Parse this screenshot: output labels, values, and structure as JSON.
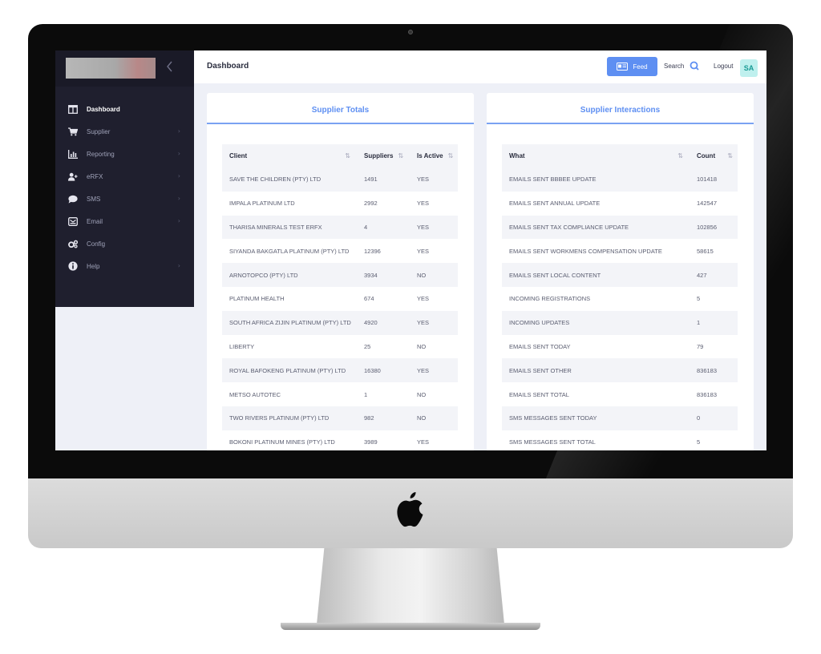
{
  "topbar": {
    "title": "Dashboard",
    "feed_label": "Feed",
    "search_label": "Search",
    "logout_label": "Logout",
    "avatar_initials": "SA"
  },
  "sidebar": {
    "items": [
      {
        "label": "Dashboard",
        "icon": "columns-icon",
        "active": true,
        "chevron": false
      },
      {
        "label": "Supplier",
        "icon": "cart-icon",
        "active": false,
        "chevron": true
      },
      {
        "label": "Reporting",
        "icon": "chart-icon",
        "active": false,
        "chevron": true
      },
      {
        "label": "eRFX",
        "icon": "user-plus-icon",
        "active": false,
        "chevron": true
      },
      {
        "label": "SMS",
        "icon": "chat-bubble-icon",
        "active": false,
        "chevron": true
      },
      {
        "label": "Email",
        "icon": "envelope-icon",
        "active": false,
        "chevron": true
      },
      {
        "label": "Config",
        "icon": "cogs-icon",
        "active": false,
        "chevron": false
      },
      {
        "label": "Help",
        "icon": "info-icon",
        "active": false,
        "chevron": true
      }
    ]
  },
  "supplier_totals": {
    "title": "Supplier Totals",
    "columns": [
      "Client",
      "Suppliers",
      "Is Active"
    ],
    "rows": [
      [
        "SAVE THE CHILDREN (PTY) LTD",
        "1491",
        "YES"
      ],
      [
        "IMPALA PLATINUM LTD",
        "2992",
        "YES"
      ],
      [
        "THARISA MINERALS TEST ERFX",
        "4",
        "YES"
      ],
      [
        "SIYANDA BAKGATLA PLATINUM (PTY) LTD",
        "12396",
        "YES"
      ],
      [
        "ARNOTOPCO (PTY) LTD",
        "3934",
        "NO"
      ],
      [
        "PLATINUM HEALTH",
        "674",
        "YES"
      ],
      [
        "SOUTH AFRICA ZIJIN PLATINUM (PTY) LTD",
        "4920",
        "YES"
      ],
      [
        "LIBERTY",
        "25",
        "NO"
      ],
      [
        "ROYAL BAFOKENG PLATINUM (PTY) LTD",
        "16380",
        "YES"
      ],
      [
        "METSO AUTOTEC",
        "1",
        "NO"
      ],
      [
        "TWO RIVERS PLATINUM (PTY) LTD",
        "982",
        "NO"
      ],
      [
        "BOKONI PLATINUM MINES (PTY) LTD",
        "3989",
        "YES"
      ]
    ]
  },
  "supplier_interactions": {
    "title": "Supplier Interactions",
    "columns": [
      "What",
      "Count"
    ],
    "rows": [
      [
        "EMAILS SENT BBBEE UPDATE",
        "101418"
      ],
      [
        "EMAILS SENT ANNUAL UPDATE",
        "142547"
      ],
      [
        "EMAILS SENT TAX COMPLIANCE UPDATE",
        "102856"
      ],
      [
        "EMAILS SENT WORKMENS COMPENSATION UPDATE",
        "58615"
      ],
      [
        "EMAILS SENT LOCAL CONTENT",
        "427"
      ],
      [
        "INCOMING REGISTRATIONS",
        "5"
      ],
      [
        "INCOMING UPDATES",
        "1"
      ],
      [
        "EMAILS SENT TODAY",
        "79"
      ],
      [
        "EMAILS SENT OTHER",
        "836183"
      ],
      [
        "EMAILS SENT TOTAL",
        "836183"
      ],
      [
        "SMS MESSAGES SENT TODAY",
        "0"
      ],
      [
        "SMS MESSAGES SENT TOTAL",
        "5"
      ]
    ]
  },
  "colors": {
    "accent": "#5e8ff2",
    "sidebar_bg": "#1f1f2e",
    "avatar_bg": "#bff0ee",
    "avatar_text": "#1a9b95"
  }
}
